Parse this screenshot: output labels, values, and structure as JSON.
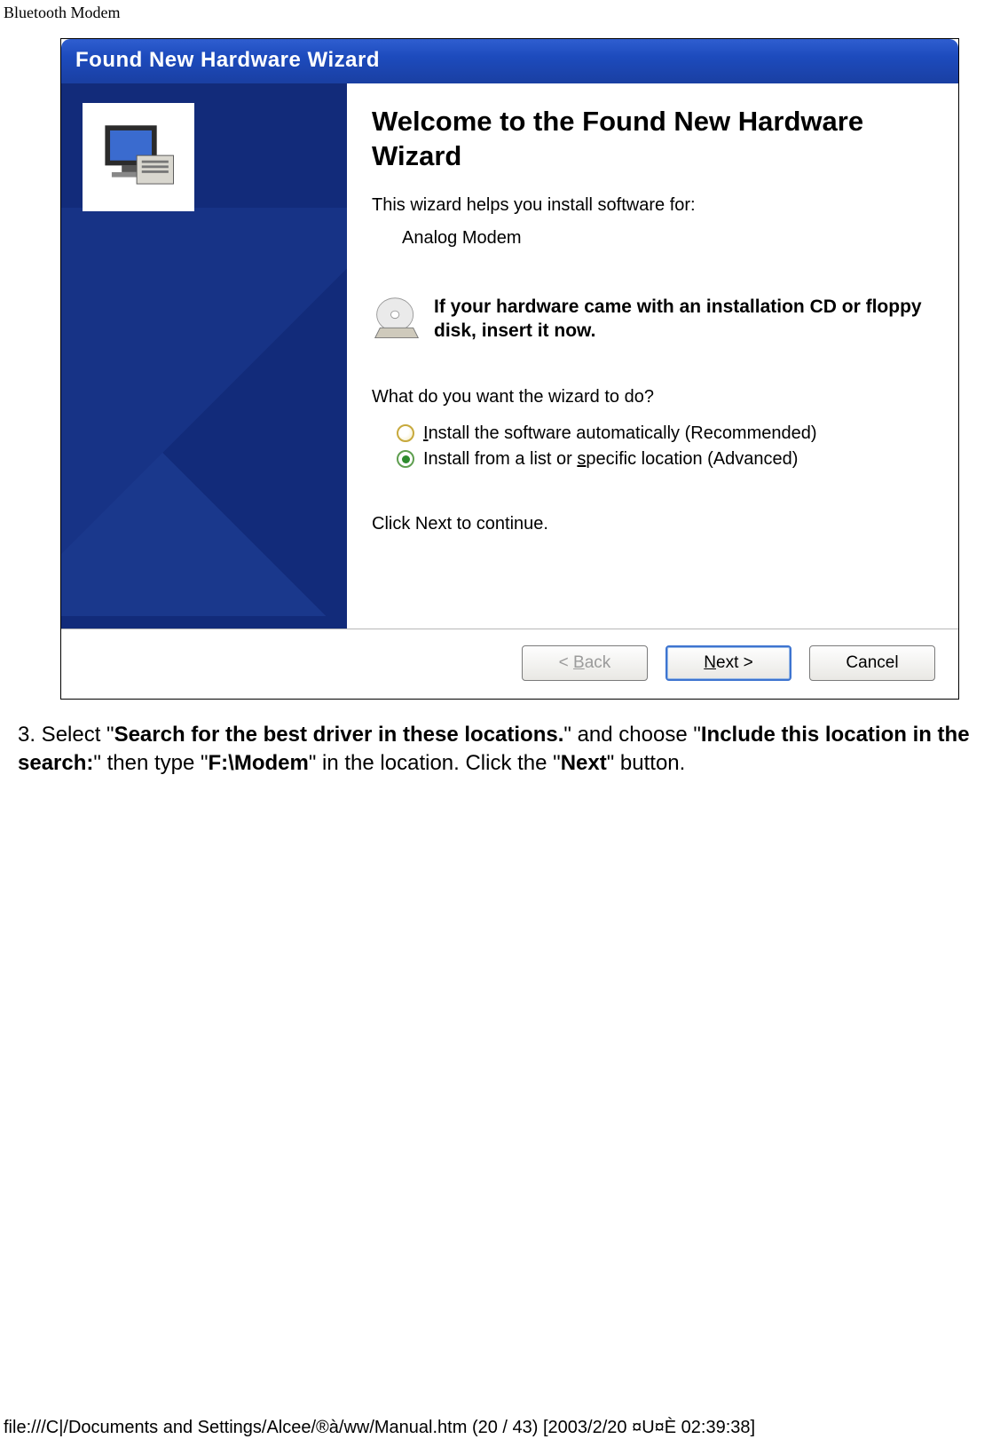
{
  "page": {
    "header": "Bluetooth Modem",
    "footer_path": "file:///C|/Documents and Settings/Alcee/®à/ww/Manual.htm (20 / 43) [2003/2/20 ¤U¤È 02:39:38]"
  },
  "wizard": {
    "title": "Found New Hardware Wizard",
    "welcome": "Welcome to the Found New Hardware Wizard",
    "helps_text": "This wizard helps you install software for:",
    "device_name": "Analog Modem",
    "cd_text": "If your hardware came with an installation CD or floppy disk, insert it now.",
    "question": "What do you want the wizard to do?",
    "radio_auto": "Install the software automatically (Recommended)",
    "radio_list": "Install from a list or specific location (Advanced)",
    "continue_text": "Click Next to continue.",
    "buttons": {
      "back": "< Back",
      "next": "Next >",
      "cancel": "Cancel"
    }
  },
  "instruction": {
    "prefix": "3. Select \"",
    "bold1": "Search for the best driver in these locations.",
    "mid1": "\" and choose \"",
    "bold2": "Include this location in the search:",
    "mid2": "\" then type \"",
    "bold3": "F:\\Modem",
    "mid3": "\" in the location. Click the \"",
    "bold4": "Next",
    "suffix": "\" button."
  }
}
